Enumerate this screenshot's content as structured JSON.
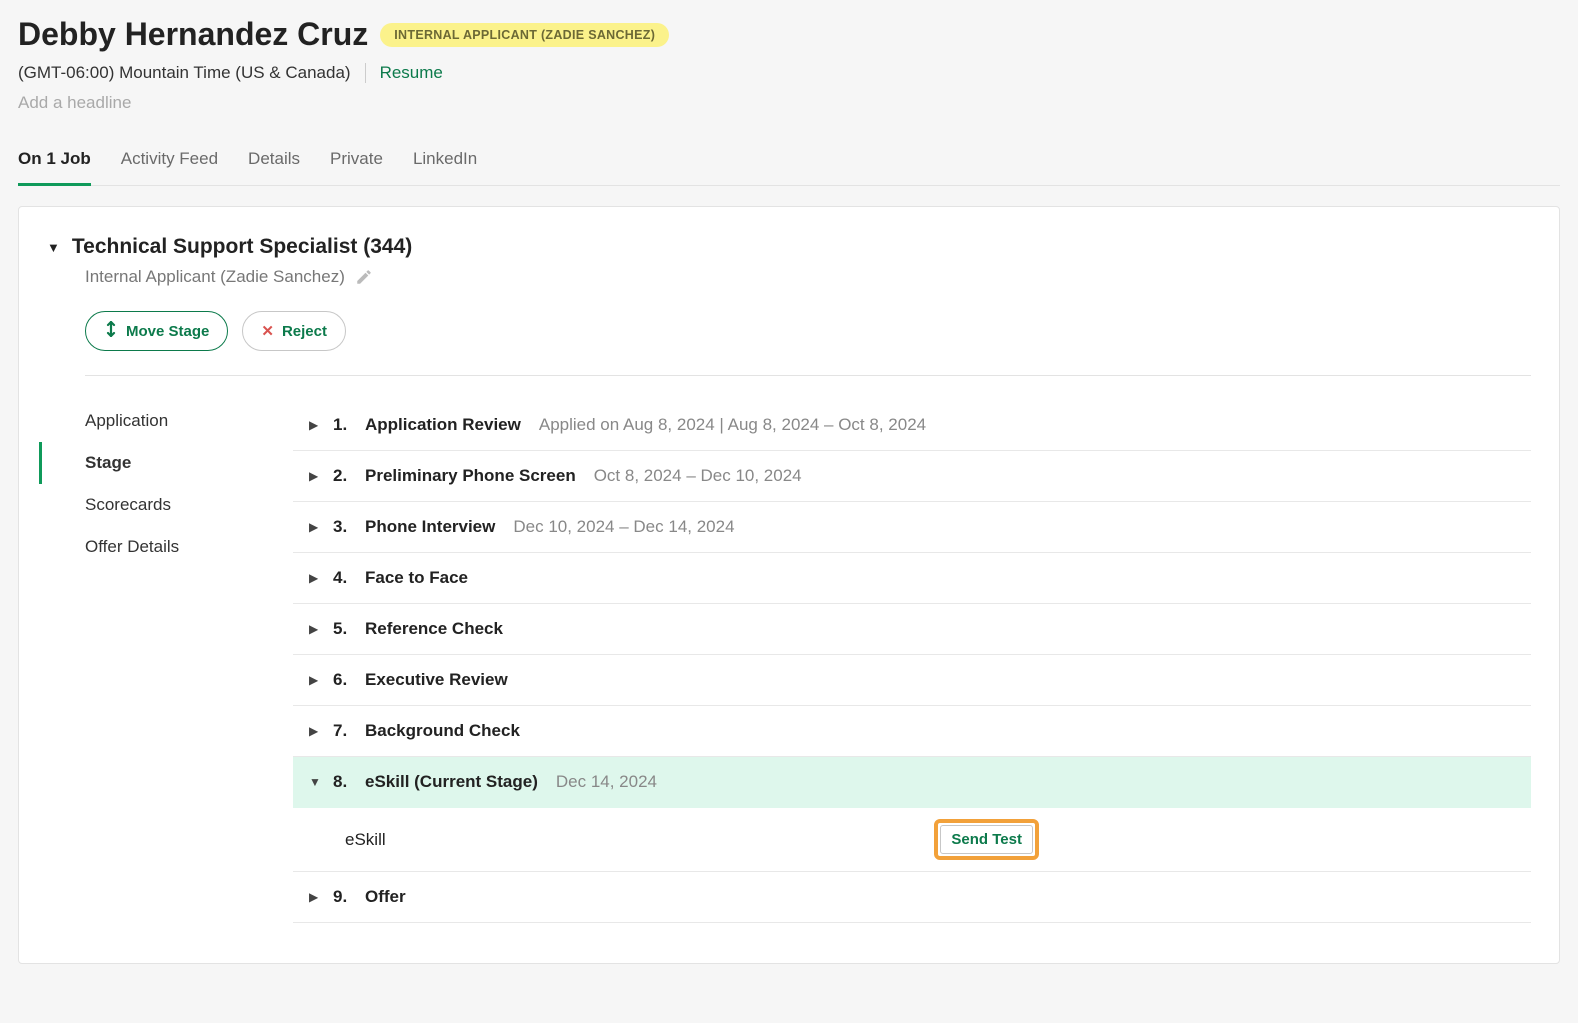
{
  "header": {
    "name": "Debby Hernandez Cruz",
    "badge": "INTERNAL APPLICANT (ZADIE SANCHEZ)",
    "timezone": "(GMT-06:00) Mountain Time (US & Canada)",
    "resume_label": "Resume",
    "headline_placeholder": "Add a headline"
  },
  "tabs": [
    {
      "label": "On 1 Job",
      "active": true
    },
    {
      "label": "Activity Feed",
      "active": false
    },
    {
      "label": "Details",
      "active": false
    },
    {
      "label": "Private",
      "active": false
    },
    {
      "label": "LinkedIn",
      "active": false
    }
  ],
  "job": {
    "title": "Technical Support Specialist (344)",
    "subtitle": "Internal Applicant (Zadie Sanchez)",
    "move_stage_label": "Move Stage",
    "reject_label": "Reject"
  },
  "side_nav": [
    {
      "label": "Application",
      "active": false
    },
    {
      "label": "Stage",
      "active": true
    },
    {
      "label": "Scorecards",
      "active": false
    },
    {
      "label": "Offer Details",
      "active": false
    }
  ],
  "stages": [
    {
      "num": "1.",
      "name": "Application Review",
      "dates": "Applied on Aug 8, 2024 | Aug 8, 2024 – Oct 8, 2024",
      "expanded": false,
      "current": false
    },
    {
      "num": "2.",
      "name": "Preliminary Phone Screen",
      "dates": "Oct 8, 2024 – Dec 10, 2024",
      "expanded": false,
      "current": false
    },
    {
      "num": "3.",
      "name": "Phone Interview",
      "dates": "Dec 10, 2024 – Dec 14, 2024",
      "expanded": false,
      "current": false
    },
    {
      "num": "4.",
      "name": "Face to Face",
      "dates": "",
      "expanded": false,
      "current": false
    },
    {
      "num": "5.",
      "name": "Reference Check",
      "dates": "",
      "expanded": false,
      "current": false
    },
    {
      "num": "6.",
      "name": "Executive Review",
      "dates": "",
      "expanded": false,
      "current": false
    },
    {
      "num": "7.",
      "name": "Background Check",
      "dates": "",
      "expanded": false,
      "current": false
    },
    {
      "num": "8.",
      "name": "eSkill (Current Stage)",
      "dates": "Dec 14, 2024",
      "expanded": true,
      "current": true,
      "sub": {
        "label": "eSkill",
        "button": "Send Test"
      }
    },
    {
      "num": "9.",
      "name": "Offer",
      "dates": "",
      "expanded": false,
      "current": false
    }
  ]
}
